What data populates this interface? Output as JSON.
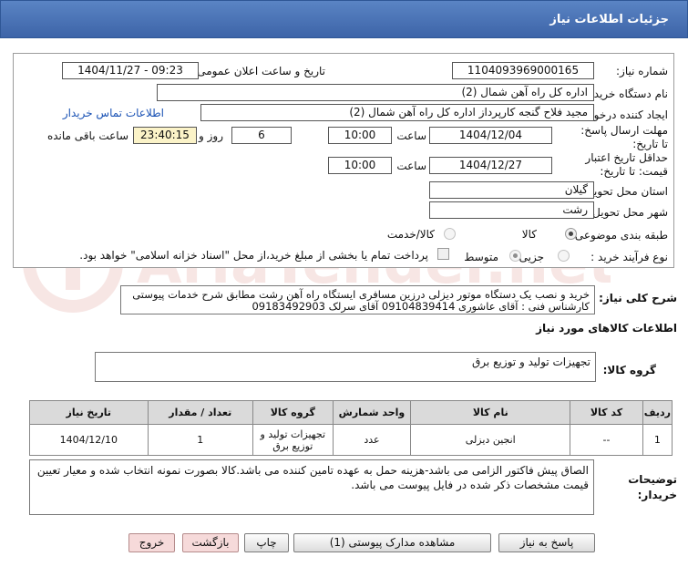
{
  "header": {
    "title": "جزئیات اطلاعات نیاز"
  },
  "form": {
    "need_number_label": "شماره نیاز:",
    "need_number": "1104093969000165",
    "announce_label": "تاریخ و ساعت اعلان عمومی:",
    "announce_value": "1404/11/27 - 09:23",
    "buyer_org_label": "نام دستگاه خریدار:",
    "buyer_org": "اداره کل راه آهن شمال (2)",
    "creator_label": "ایجاد کننده درخواست:",
    "creator": "مجید فلاح گنجه کارپرداز اداره کل راه آهن شمال (2)",
    "contact_link": "اطلاعات تماس خریدار",
    "deadline_label": "مهلت ارسال پاسخ: تا تاریخ:",
    "deadline_date": "1404/12/04",
    "time_label": "ساعت",
    "deadline_time": "10:00",
    "days_value": "6",
    "days_label": "روز و",
    "remaining_time": "23:40:15",
    "remaining_label": "ساعت باقی مانده",
    "validity_label": "حداقل تاریخ اعتبار قیمت: تا تاریخ:",
    "validity_date": "1404/12/27",
    "validity_time": "10:00",
    "province_label": "استان محل تحویل:",
    "province": "گیلان",
    "city_label": "شهر محل تحویل:",
    "city": "رشت",
    "category_label": "طبقه بندی موضوعی:",
    "category_options": [
      "کالا",
      "کالا/خدمت"
    ],
    "process_label": "نوع فرآیند خرید :",
    "process_options": [
      "جزیی",
      "متوسط"
    ],
    "payment_note": "پرداخت تمام یا بخشی از مبلغ خرید،از محل \"اسناد خزانه اسلامی\" خواهد بود."
  },
  "description": {
    "label": "شرح کلی نیاز:",
    "text": "خرید و نصب یک دستگاه موتور دیزلی درزین مسافری ایستگاه راه آهن رشت مطابق شرح خدمات پیوستی کارشناس فنی : آقای عاشوری 09104839414 آقای سرلک 09183492903"
  },
  "goods": {
    "section_title": "اطلاعات کالاهای مورد نیاز",
    "group_label": "گروه کالا:",
    "group_value": "تجهیزات تولید و توزیع برق",
    "columns": [
      "ردیف",
      "کد کالا",
      "نام کالا",
      "واحد شمارش",
      "گروه کالا",
      "تعداد / مقدار",
      "تاریخ نیاز"
    ],
    "rows": [
      [
        "1",
        "--",
        "انجین دیزلی",
        "عدد",
        "تجهیزات تولید و توزیع برق",
        "1",
        "1404/12/10"
      ]
    ]
  },
  "buyer_notes": {
    "label": "توضیحات خریدار:",
    "text": "الصاق پیش فاکتور الزامی می باشد-هزینه حمل به عهده تامین کننده می باشد.کالا بصورت نمونه انتخاب شده و معیار تعیین قیمت مشخصات ذکر شده در فایل پیوست می باشد."
  },
  "buttons": {
    "reply": "پاسخ به نیاز",
    "attachments": "مشاهده مدارک پیوستی (1)",
    "print": "چاپ",
    "back": "بازگشت",
    "exit": "خروج"
  },
  "watermark": {
    "text": "AriaTender.net"
  },
  "colors": {
    "header": "#4a74b8",
    "link": "#1b53b5",
    "highlight": "#fbf3c8"
  }
}
